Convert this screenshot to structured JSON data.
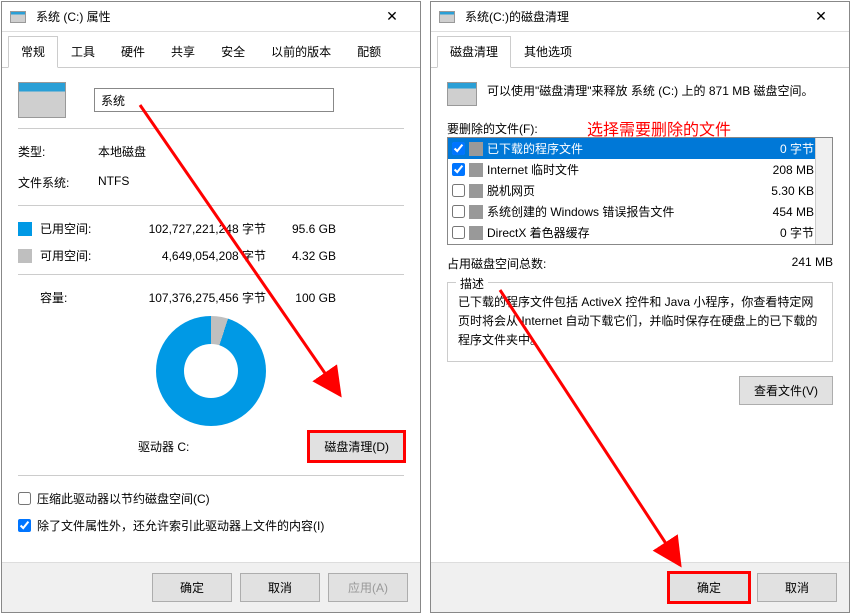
{
  "left": {
    "title": "系统 (C:) 属性",
    "tabs": [
      "常规",
      "工具",
      "硬件",
      "共享",
      "安全",
      "以前的版本",
      "配额"
    ],
    "active_tab": 0,
    "name_value": "系统",
    "type_label": "类型:",
    "type_value": "本地磁盘",
    "fs_label": "文件系统:",
    "fs_value": "NTFS",
    "used_label": "已用空间:",
    "used_bytes": "102,727,221,248 字节",
    "used_gb": "95.6 GB",
    "free_label": "可用空间:",
    "free_bytes": "4,649,054,208 字节",
    "free_gb": "4.32 GB",
    "capacity_label": "容量:",
    "capacity_bytes": "107,376,275,456 字节",
    "capacity_gb": "100 GB",
    "drive_label": "驱动器 C:",
    "cleanup_btn": "磁盘清理(D)",
    "compress_label": "压缩此驱动器以节约磁盘空间(C)",
    "index_label": "除了文件属性外，还允许索引此驱动器上文件的内容(I)",
    "ok": "确定",
    "cancel": "取消",
    "apply": "应用(A)"
  },
  "right": {
    "title": "系统(C:)的磁盘清理",
    "tabs": [
      "磁盘清理",
      "其他选项"
    ],
    "active_tab": 0,
    "intro": "可以使用\"磁盘清理\"来释放 系统 (C:) 上的 871 MB 磁盘空间。",
    "delete_label": "要删除的文件(F):",
    "annotation": "选择需要删除的文件",
    "files": [
      {
        "checked": true,
        "name": "已下载的程序文件",
        "size": "0 字节",
        "selected": true
      },
      {
        "checked": true,
        "name": "Internet 临时文件",
        "size": "208 MB",
        "selected": false
      },
      {
        "checked": false,
        "name": "脱机网页",
        "size": "5.30 KB",
        "selected": false
      },
      {
        "checked": false,
        "name": "系统创建的 Windows 错误报告文件",
        "size": "454 MB",
        "selected": false
      },
      {
        "checked": false,
        "name": "DirectX 着色器缓存",
        "size": "0 字节",
        "selected": false
      }
    ],
    "total_label": "占用磁盘空间总数:",
    "total_value": "241 MB",
    "desc_legend": "描述",
    "desc_text": "已下载的程序文件包括 ActiveX 控件和 Java 小程序，你查看特定网页时将会从 Internet 自动下载它们，并临时保存在硬盘上的已下载的程序文件夹中。",
    "view_btn": "查看文件(V)",
    "ok": "确定",
    "cancel": "取消"
  },
  "colors": {
    "accent": "#0099e5",
    "highlight": "#ff0000",
    "selection": "#0078d7"
  }
}
